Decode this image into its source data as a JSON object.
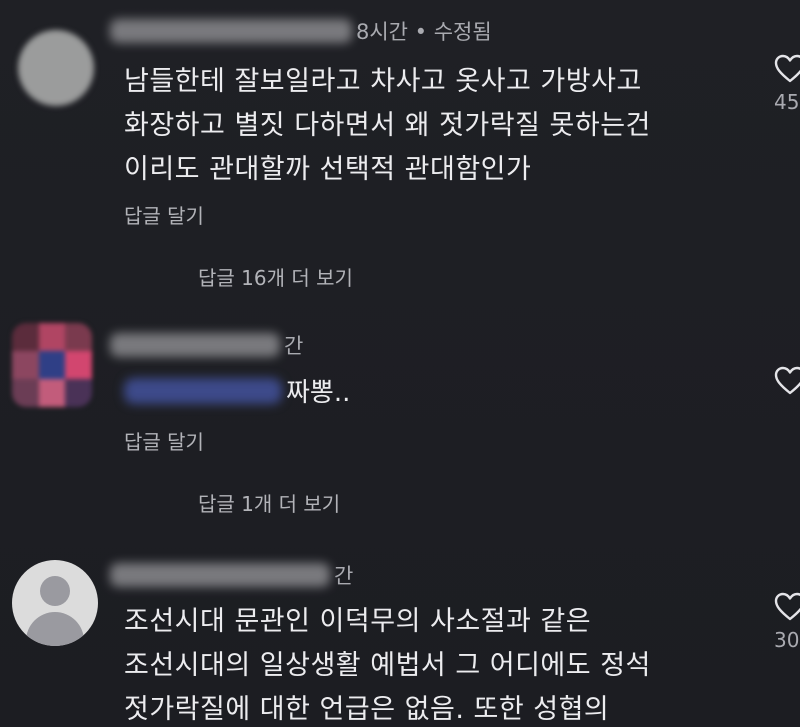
{
  "comments": [
    {
      "time_text": "8시간 • 수정됨",
      "lines": [
        "남들한테 잘보일라고 차사고 옷사고 가방사고",
        "화장하고 별짓 다하면서 왜 젓가락질 못하는건",
        "이리도 관대할까 선택적 관대함인가"
      ],
      "reply_label": "답글 달기",
      "more_replies_label": "답글 16개 더 보기",
      "like_count": "45"
    },
    {
      "time_text": "간",
      "mention_tail": "짜뽕..",
      "reply_label": "답글 달기",
      "more_replies_label": "답글 1개 더 보기"
    },
    {
      "time_text": "간",
      "lines": [
        "조선시대 문관인 이덕무의 사소절과 같은",
        "조선시대의 일상생활 예법서 그 어디에도 정석",
        "젓가락질에 대한 언급은 없음. 또한 성협의"
      ],
      "like_count": "30"
    }
  ],
  "colors": {
    "background": "#1e1f24",
    "text": "#ececef",
    "muted": "#a9aab0"
  },
  "icons": [
    "heart-outline-icon",
    "default-avatar-icon"
  ]
}
